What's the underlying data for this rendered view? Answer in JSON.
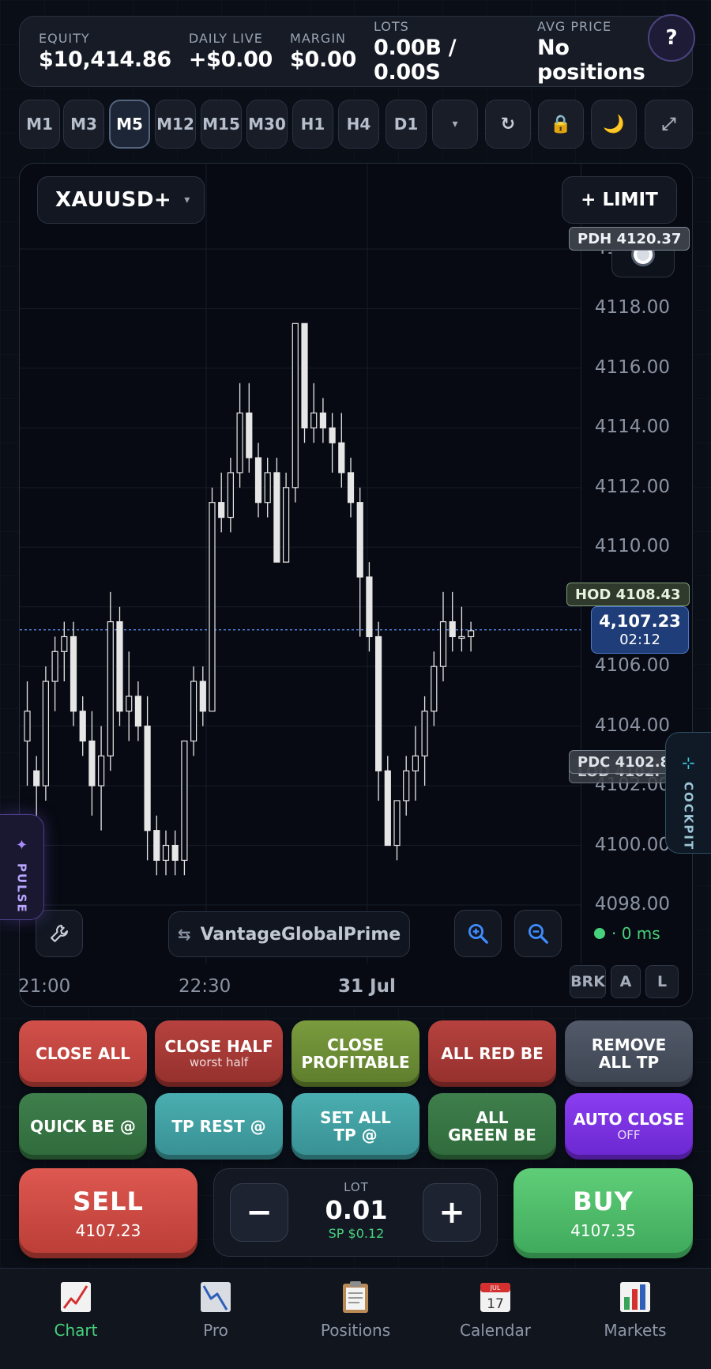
{
  "stats": {
    "equity_label": "EQUITY",
    "equity": "$10,414.86",
    "daily_label": "DAILY LIVE",
    "daily": "+$0.00",
    "margin_label": "MARGIN",
    "margin": "$0.00",
    "lots_label": "LOTS",
    "lots": "0.00B / 0.00S",
    "avg_label": "AVG PRICE",
    "avg": "No positions",
    "help": "?"
  },
  "timeframes": [
    "M1",
    "M3",
    "M5",
    "M12",
    "M15",
    "M30",
    "H1",
    "H4",
    "D1"
  ],
  "active_timeframe": "M5",
  "toolbar": {
    "more": "▾",
    "refresh": "↻",
    "lock": "🔒",
    "theme": "🌙",
    "expand": "⤢"
  },
  "chart": {
    "symbol": "XAUUSD+",
    "symbol_caret": "▾",
    "limit_label": "+ LIMIT",
    "y_ticks": [
      "4120.00",
      "4118.00",
      "4116.00",
      "4114.00",
      "4112.00",
      "4110.00",
      "4108.00",
      "4106.00",
      "4104.00",
      "4102.00",
      "4100.00",
      "4098.00"
    ],
    "x_ticks": [
      "21:00",
      "22:30",
      "31 Jul"
    ],
    "pdh": "PDH 4120.37",
    "hod": "HOD 4108.43",
    "pdc": "PDC 4102.8",
    "lod": "LOD 4102.",
    "current_price": "4,107.23",
    "countdown": "02:12",
    "latency": "· 0 ms",
    "broker": "VantageGlobalPrime",
    "broker_icon": "⇆",
    "modes": [
      "BRK",
      "A",
      "L"
    ],
    "pulse": "PULSE",
    "cockpit": "COCKPIT"
  },
  "chart_data": {
    "type": "candlestick",
    "ylim": [
      4097,
      4121
    ],
    "current_price": 4107.23,
    "candles": [
      [
        4103.5,
        4105.5,
        4102.0,
        4104.5
      ],
      [
        4102.5,
        4103.0,
        4101.0,
        4102.0
      ],
      [
        4102.0,
        4106.0,
        4101.5,
        4105.5
      ],
      [
        4105.5,
        4107.0,
        4104.5,
        4106.5
      ],
      [
        4106.5,
        4107.5,
        4105.5,
        4107.0
      ],
      [
        4107.0,
        4107.5,
        4104.0,
        4104.5
      ],
      [
        4104.5,
        4105.0,
        4103.0,
        4103.5
      ],
      [
        4103.5,
        4104.5,
        4101.0,
        4102.0
      ],
      [
        4102.0,
        4104.0,
        4100.5,
        4103.0
      ],
      [
        4103.0,
        4108.5,
        4102.5,
        4107.5
      ],
      [
        4107.5,
        4108.0,
        4104.0,
        4104.5
      ],
      [
        4104.5,
        4106.5,
        4103.5,
        4105.0
      ],
      [
        4105.0,
        4105.5,
        4103.5,
        4104.0
      ],
      [
        4104.0,
        4105.0,
        4099.5,
        4100.5
      ],
      [
        4100.5,
        4101.0,
        4099.0,
        4099.5
      ],
      [
        4099.5,
        4100.5,
        4099.0,
        4100.0
      ],
      [
        4100.0,
        4100.5,
        4099.0,
        4099.5
      ],
      [
        4099.5,
        4103.5,
        4099.0,
        4103.5
      ],
      [
        4103.5,
        4106.0,
        4103.0,
        4105.5
      ],
      [
        4105.5,
        4106.0,
        4104.0,
        4104.5
      ],
      [
        4104.5,
        4112.0,
        4104.5,
        4111.5
      ],
      [
        4111.5,
        4112.5,
        4110.5,
        4111.0
      ],
      [
        4111.0,
        4113.0,
        4110.5,
        4112.5
      ],
      [
        4112.5,
        4115.5,
        4112.0,
        4114.5
      ],
      [
        4114.5,
        4115.5,
        4112.5,
        4113.0
      ],
      [
        4113.0,
        4113.5,
        4111.0,
        4111.5
      ],
      [
        4111.5,
        4113.0,
        4111.0,
        4112.5
      ],
      [
        4112.5,
        4113.0,
        4109.5,
        4109.5
      ],
      [
        4109.5,
        4112.5,
        4109.5,
        4112.0
      ],
      [
        4112.0,
        4117.5,
        4111.5,
        4117.5
      ],
      [
        4117.5,
        4117.5,
        4113.5,
        4114.0
      ],
      [
        4114.0,
        4115.5,
        4113.5,
        4114.5
      ],
      [
        4114.5,
        4115.0,
        4113.5,
        4114.0
      ],
      [
        4114.0,
        4114.5,
        4112.5,
        4113.5
      ],
      [
        4113.5,
        4114.5,
        4112.0,
        4112.5
      ],
      [
        4112.5,
        4113.0,
        4111.0,
        4111.5
      ],
      [
        4111.5,
        4112.0,
        4107.0,
        4109.0
      ],
      [
        4109.0,
        4109.5,
        4106.5,
        4107.0
      ],
      [
        4107.0,
        4107.5,
        4101.5,
        4102.5
      ],
      [
        4102.5,
        4103.0,
        4100.0,
        4100.0
      ],
      [
        4100.0,
        4101.5,
        4099.5,
        4101.5
      ],
      [
        4101.5,
        4103.0,
        4101.0,
        4102.5
      ],
      [
        4102.5,
        4104.0,
        4101.5,
        4103.0
      ],
      [
        4103.0,
        4105.0,
        4102.0,
        4104.5
      ],
      [
        4104.5,
        4106.5,
        4104.0,
        4106.0
      ],
      [
        4106.0,
        4108.5,
        4105.5,
        4107.5
      ],
      [
        4107.5,
        4108.5,
        4106.5,
        4107.0
      ],
      [
        4107.0,
        4108.0,
        4106.5,
        4107.0
      ],
      [
        4107.0,
        4107.5,
        4106.5,
        4107.2
      ]
    ]
  },
  "actions": [
    {
      "label": "CLOSE ALL",
      "sub": "",
      "style": "red"
    },
    {
      "label": "CLOSE HALF",
      "sub": "worst half",
      "style": "dred"
    },
    {
      "label": "CLOSE PROFITABLE",
      "sub": "",
      "style": "olive"
    },
    {
      "label": "ALL RED BE",
      "sub": "",
      "style": "dred"
    },
    {
      "label": "REMOVE ALL TP",
      "sub": "",
      "style": "slate"
    },
    {
      "label": "QUICK BE @",
      "sub": "",
      "style": "green"
    },
    {
      "label": "TP REST @",
      "sub": "",
      "style": "teal"
    },
    {
      "label": "SET ALL TP @",
      "sub": "",
      "style": "teal"
    },
    {
      "label": "ALL GREEN BE",
      "sub": "",
      "style": "green"
    },
    {
      "label": "AUTO CLOSE",
      "sub": "OFF",
      "style": "violet"
    }
  ],
  "trade": {
    "sell_label": "SELL",
    "sell_price": "4107.23",
    "buy_label": "BUY",
    "buy_price": "4107.35",
    "lot_label": "LOT",
    "lot_value": "0.01",
    "spread": "SP $0.12",
    "minus": "−",
    "plus": "+"
  },
  "nav": [
    {
      "label": "Chart",
      "icon": "chart-icon",
      "active": true
    },
    {
      "label": "Pro",
      "icon": "pro-chart-icon",
      "active": false
    },
    {
      "label": "Positions",
      "icon": "clipboard-icon",
      "active": false
    },
    {
      "label": "Calendar",
      "icon": "calendar-icon",
      "active": false
    },
    {
      "label": "Markets",
      "icon": "bar-chart-icon",
      "active": false
    }
  ],
  "calendar_icon": {
    "month": "JUL",
    "day": "17"
  },
  "colors": {
    "background": "#0a0e17",
    "sell": "#d2504a",
    "buy": "#4fbf6a",
    "price_line": "#4d7ad0",
    "active_nav": "#46d17c",
    "candle": "#e6e6e6"
  }
}
